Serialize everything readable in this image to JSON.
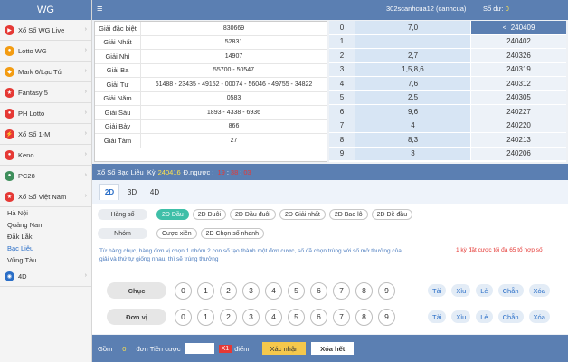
{
  "app": {
    "title": "WG"
  },
  "sidebar": {
    "items": [
      {
        "label": "Xổ Số WG Live",
        "icon": "play-icon",
        "color": "#e53935"
      },
      {
        "label": "Lotto WG",
        "icon": "lotto-icon",
        "color": "#f39c12"
      },
      {
        "label": "Mark 6/Lạc Tú",
        "icon": "mark6-icon",
        "color": "#f39c12"
      },
      {
        "label": "Fantasy 5",
        "icon": "star-icon",
        "color": "#e53935"
      },
      {
        "label": "PH Lotto",
        "icon": "ph-icon",
        "color": "#e53935"
      },
      {
        "label": "Xổ Số 1-M",
        "icon": "lightning-icon",
        "color": "#e53935"
      },
      {
        "label": "Keno",
        "icon": "keno-icon",
        "color": "#e53935"
      },
      {
        "label": "PC28",
        "icon": "pc28-icon",
        "color": "#3f8f5c"
      },
      {
        "label": "Xổ Số Việt Nam",
        "icon": "vn-flag-icon",
        "color": "#e53935"
      }
    ],
    "sub_items": [
      "Hà Nội",
      "Quảng Nam",
      "Đắk Lắk",
      "Bạc Liêu",
      "Vũng Tàu"
    ],
    "active_sub": "Bạc Liêu",
    "item_4d": {
      "label": "4D",
      "icon": "globe-icon",
      "color": "#2a6ec7"
    }
  },
  "header": {
    "account": "302scanhcua12 (canhcua)",
    "balance_label": "Số dư:",
    "balance_value": "0"
  },
  "results": [
    {
      "label": "Giải đặc biệt",
      "value": "830669"
    },
    {
      "label": "Giải Nhất",
      "value": "52831"
    },
    {
      "label": "Giải Nhì",
      "value": "14907"
    },
    {
      "label": "Giải Ba",
      "value": "55700 - 50547"
    },
    {
      "label": "Giải Tư",
      "value": "61488 - 23435 - 49152 - 00074 - 56046 - 49755 - 34822"
    },
    {
      "label": "Giải Năm",
      "value": "0583"
    },
    {
      "label": "Giải Sáu",
      "value": "1893 - 4338 - 6936"
    },
    {
      "label": "Giải Bảy",
      "value": "866"
    },
    {
      "label": "Giải Tám",
      "value": "27"
    }
  ],
  "history": [
    {
      "head": "0",
      "tail": "7,0",
      "period": "240409",
      "arrow": "<"
    },
    {
      "head": "1",
      "tail": "",
      "period": "240402",
      "arrow": ""
    },
    {
      "head": "2",
      "tail": "2,7",
      "period": "240326",
      "arrow": ""
    },
    {
      "head": "3",
      "tail": "1,5,8,6",
      "period": "240319",
      "arrow": ""
    },
    {
      "head": "4",
      "tail": "7,6",
      "period": "240312",
      "arrow": ""
    },
    {
      "head": "5",
      "tail": "2,5",
      "period": "240305",
      "arrow": ""
    },
    {
      "head": "6",
      "tail": "9,6",
      "period": "240227",
      "arrow": ""
    },
    {
      "head": "7",
      "tail": "4",
      "period": "240220",
      "arrow": ""
    },
    {
      "head": "8",
      "tail": "8,3",
      "period": "240213",
      "arrow": ""
    },
    {
      "head": "9",
      "tail": "3",
      "period": "240206",
      "arrow": ""
    }
  ],
  "draw": {
    "name": "Xổ Số Bạc Liêu",
    "period_label": "Kỳ",
    "period": "240416",
    "countdown_label": "Đ.ngược :",
    "h": "19",
    "m": "38",
    "s": "03"
  },
  "tabs": [
    "2D",
    "3D",
    "4D"
  ],
  "bet_types": {
    "label": "Hàng số",
    "options": [
      "2D Đầu",
      "2D Đuôi",
      "2D Đầu đuôi",
      "2D Giải nhất",
      "2D Bao lô",
      "2D Đề đầu"
    ]
  },
  "groups": {
    "label": "Nhóm",
    "options": [
      "Cược xiên",
      "2D Chọn số nhanh"
    ]
  },
  "description": "Từ hàng chục, hàng đơn vị chọn 1 nhóm 2 con số tạo thành một đơn cược, số đã chọn trùng với số mở thưởng của giải và thứ tự giống nhau, thì sẽ trúng thưởng",
  "limit": "1 kỳ đặt cược tối đa 65 tổ hợp số",
  "rows": [
    {
      "label": "Chục"
    },
    {
      "label": "Đơn vị"
    }
  ],
  "digits": [
    "0",
    "1",
    "2",
    "3",
    "4",
    "5",
    "6",
    "7",
    "8",
    "9"
  ],
  "quick": [
    "Tài",
    "Xỉu",
    "Lẻ",
    "Chẵn",
    "Xóa"
  ],
  "footer": {
    "total_label": "Gồm",
    "total": "0",
    "unit_label": "đơn",
    "amount_label": "Tiền cược",
    "mult": "X1",
    "point": "điểm",
    "confirm": "Xác nhận",
    "clear": "Xóa hết"
  }
}
